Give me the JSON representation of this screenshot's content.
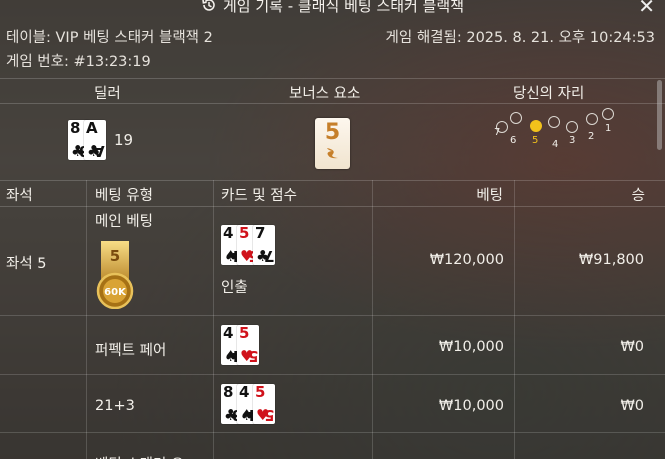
{
  "window": {
    "title": "게임 기록 - 클래식 베팅 스태커 블랙잭",
    "close_glyph": "✕"
  },
  "info": {
    "table_label": "테이블: VIP 베팅 스태커 블랙잭 2",
    "resolved_label": "게임 해결됨: 2025. 8. 21. 오후 10:24:53",
    "game_number": "게임 번호: #13:23:19"
  },
  "sections": {
    "dealer": "딜러",
    "bonus": "보너스 요소",
    "your_seat": "당신의 자리"
  },
  "dealer": {
    "cards": [
      {
        "rank": "8",
        "suit": "♣",
        "red": false
      },
      {
        "rank": "A",
        "suit": "♣",
        "red": false
      }
    ],
    "score": "19"
  },
  "bonus_card": "5",
  "seats": {
    "numbers": [
      "7",
      "6",
      "5",
      "4",
      "3",
      "2",
      "1"
    ],
    "active": "5"
  },
  "table": {
    "headers": {
      "seat": "좌석",
      "bet_type": "베팅 유형",
      "cards_score": "카드 및 점수",
      "bet": "베팅",
      "win": "승"
    },
    "seat_label": "좌석 5",
    "chip": {
      "top": "5",
      "value": "60K"
    },
    "rows": [
      {
        "type": "메인 베팅",
        "cards": [
          {
            "rank": "4",
            "suit": "♠",
            "red": false
          },
          {
            "rank": "5",
            "suit": "♥",
            "red": true
          },
          {
            "rank": "7",
            "suit": "♣",
            "red": false
          }
        ],
        "status": "인출",
        "bet": "₩120,000",
        "win": "₩91,800"
      },
      {
        "type": "퍼펙트 페어",
        "cards": [
          {
            "rank": "4",
            "suit": "♠",
            "red": false
          },
          {
            "rank": "5",
            "suit": "♥",
            "red": true
          }
        ],
        "status": "",
        "bet": "₩10,000",
        "win": "₩0"
      },
      {
        "type": "21+3",
        "cards": [
          {
            "rank": "8",
            "suit": "♣",
            "red": false
          },
          {
            "rank": "4",
            "suit": "♠",
            "red": false
          },
          {
            "rank": "5",
            "suit": "♥",
            "red": true
          }
        ],
        "status": "",
        "bet": "₩10,000",
        "win": "₩0"
      },
      {
        "type": "베팅 스태커 오",
        "cards": [],
        "status": "",
        "bet": "",
        "win": ""
      }
    ]
  },
  "colors": {
    "accent_yellow": "#f2c21b",
    "red_suit": "#d0121b"
  }
}
